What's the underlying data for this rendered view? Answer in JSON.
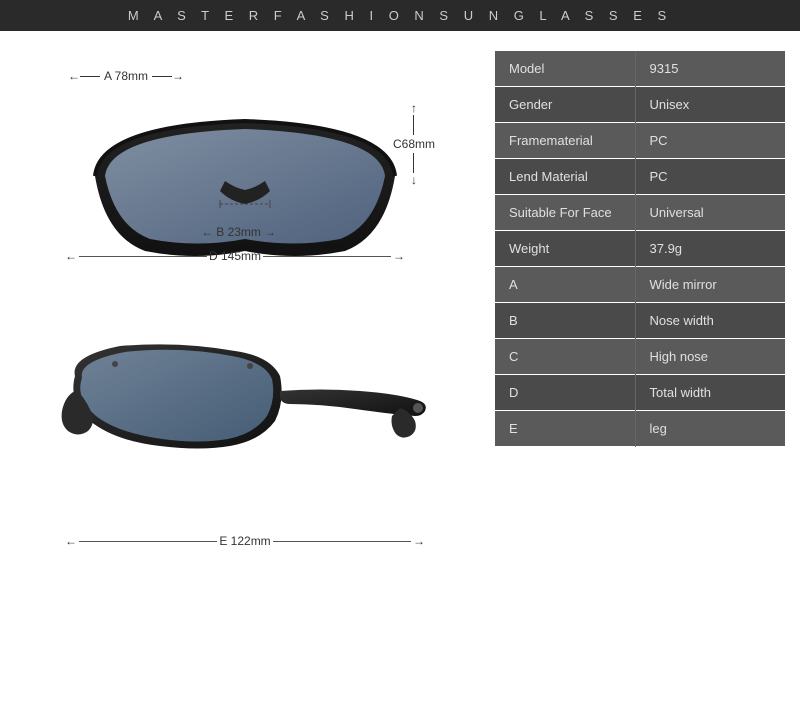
{
  "header": {
    "title": "M A S T E R F A S H I O N S U N G L A S S E S"
  },
  "measurements": {
    "a_label": "A 78mm",
    "b_label": "B 23mm",
    "c_label": "C68mm",
    "d_label": "D 145mm",
    "e_label": "E 122mm"
  },
  "specs": [
    {
      "key": "Model",
      "value": "9315"
    },
    {
      "key": "Gender",
      "value": "Unisex"
    },
    {
      "key": "Framematerial",
      "value": "PC"
    },
    {
      "key": "Lend Material",
      "value": "PC"
    },
    {
      "key": "Suitable For Face",
      "value": "Universal"
    },
    {
      "key": "Weight",
      "value": "37.9g"
    },
    {
      "key": "A",
      "value": "Wide mirror"
    },
    {
      "key": "B",
      "value": "Nose width"
    },
    {
      "key": "C",
      "value": "High nose"
    },
    {
      "key": "D",
      "value": "Total width"
    },
    {
      "key": "E",
      "value": "leg"
    }
  ]
}
